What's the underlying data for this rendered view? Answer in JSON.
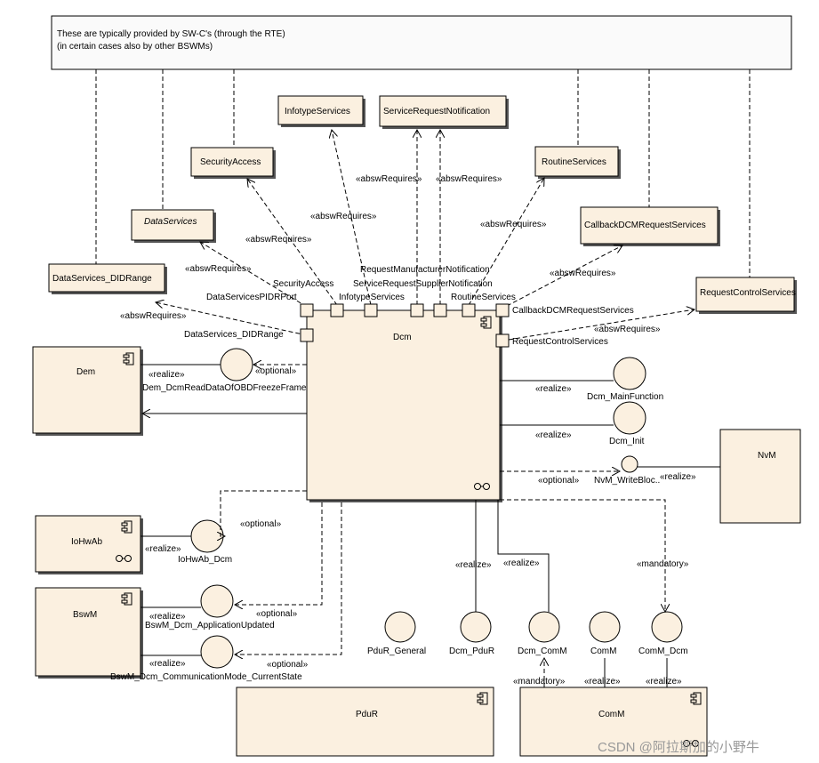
{
  "note": {
    "line1": "These are typically provided by SW-C's (through the RTE)",
    "line2": "(in certain cases also by other BSWMs)"
  },
  "interfaces_required": [
    "DataServices_DIDRange",
    "DataServices",
    "SecurityAccess",
    "InfotypeServices",
    "ServiceRequestNotification",
    "RoutineServices",
    "CallbackDCMRequestServices",
    "RequestControlServices"
  ],
  "ports": [
    "DataServicesPIDRPort",
    "SecurityAccess",
    "InfotypeServices",
    "RequestManufacturerNotification",
    "ServiceRequestSupplierNotification",
    "RoutineServices",
    "CallbackDCMRequestServices",
    "DataServices_DIDRange",
    "RequestControlServices"
  ],
  "components": {
    "dcm": "Dcm",
    "dem": "Dem",
    "iohwab": "IoHwAb",
    "bswm": "BswM",
    "nvm": "NvM",
    "pdur": "PduR",
    "comm": "ComM"
  },
  "provided": [
    "Dem_DcmReadDataOfOBDFreezeFrame",
    "Dcm_MainFunction",
    "Dcm_Init",
    "NvM_WriteBloc..",
    "IoHwAb_Dcm",
    "BswM_Dcm_ApplicationUpdated",
    "BswM_Dcm_CommunicationMode_CurrentState",
    "PduR_General",
    "Dcm_PduR",
    "Dcm_ComM",
    "ComM",
    "ComM_Dcm"
  ],
  "stereo": {
    "req": "«abswRequires»",
    "realize": "«realize»",
    "optional": "«optional»",
    "mandatory": "«mandatory»"
  },
  "watermark": "CSDN @阿拉斯加的小野牛",
  "colors": {
    "fill": "#fbf0e0"
  }
}
